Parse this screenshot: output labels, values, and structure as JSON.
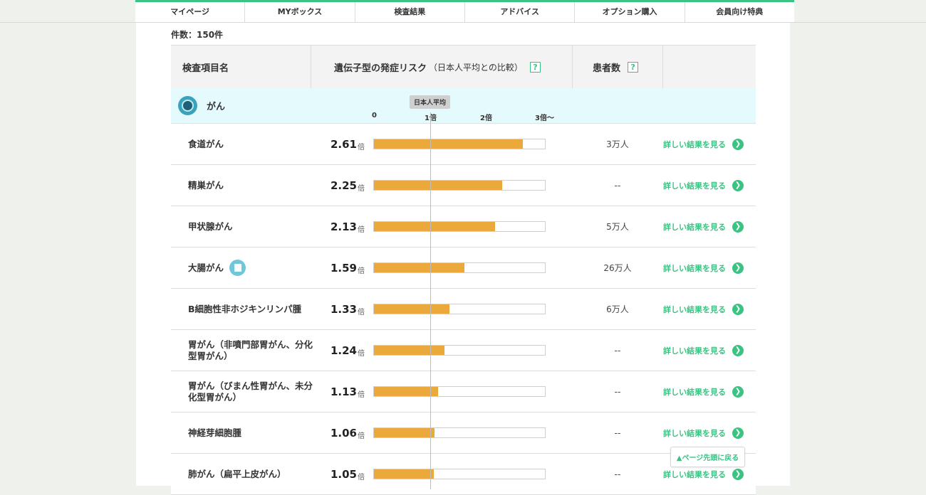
{
  "nav": [
    "マイページ",
    "MYボックス",
    "検査結果",
    "アドバイス",
    "オプション購入",
    "会員向け特典"
  ],
  "count_label": "件数：150件",
  "header": {
    "col_name": "検査項目名",
    "col_risk": "遺伝子型の発症リスク",
    "col_risk_sub": "（日本人平均との比較）",
    "col_patients": "患者数",
    "help": "?"
  },
  "category": {
    "name": "がん",
    "badge": "日本人平均",
    "ticks": [
      "0",
      "1倍",
      "2倍",
      "3倍〜"
    ]
  },
  "rows": [
    {
      "name": "食道がん",
      "value": "2.61",
      "unit": "倍",
      "risk": 2.61,
      "patients": "3万人",
      "link": "詳しい結果を見る"
    },
    {
      "name": "精巣がん",
      "value": "2.25",
      "unit": "倍",
      "risk": 2.25,
      "patients": "--",
      "link": "詳しい結果を見る"
    },
    {
      "name": "甲状腺がん",
      "value": "2.13",
      "unit": "倍",
      "risk": 2.13,
      "patients": "5万人",
      "link": "詳しい結果を見る"
    },
    {
      "name": "大腸がん",
      "value": "1.59",
      "unit": "倍",
      "risk": 1.59,
      "patients": "26万人",
      "link": "詳しい結果を見る",
      "icon": "book-icon"
    },
    {
      "name": "B細胞性非ホジキンリンパ腫",
      "value": "1.33",
      "unit": "倍",
      "risk": 1.33,
      "patients": "6万人",
      "link": "詳しい結果を見る"
    },
    {
      "name": "胃がん（非噴門部胃がん、分化型胃がん）",
      "value": "1.24",
      "unit": "倍",
      "risk": 1.24,
      "patients": "--",
      "link": "詳しい結果を見る"
    },
    {
      "name": "胃がん（びまん性胃がん、未分化型胃がん）",
      "value": "1.13",
      "unit": "倍",
      "risk": 1.13,
      "patients": "--",
      "link": "詳しい結果を見る"
    },
    {
      "name": "神経芽細胞腫",
      "value": "1.06",
      "unit": "倍",
      "risk": 1.06,
      "patients": "--",
      "link": "詳しい結果を見る"
    },
    {
      "name": "肺がん（扁平上皮がん）",
      "value": "1.05",
      "unit": "倍",
      "risk": 1.05,
      "patients": "--",
      "link": "詳しい結果を見る"
    }
  ],
  "back_to_top": "▲ページ先頭に戻る",
  "colors": {
    "accent": "#3cc384",
    "bar": "#eba93c",
    "category_bg": "#e5fafd"
  }
}
